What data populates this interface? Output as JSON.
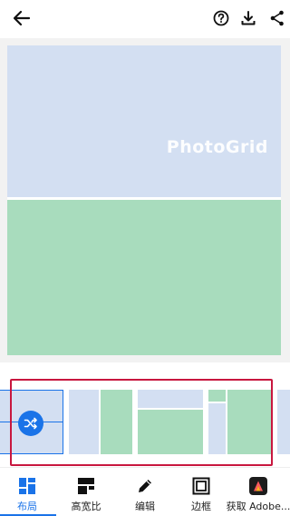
{
  "toolbar": {
    "back_icon": "arrow-left-icon",
    "help_icon": "help-circle-icon",
    "download_icon": "download-icon",
    "share_icon": "share-icon"
  },
  "canvas": {
    "watermark": "PhotoGrid",
    "top_cell_color": "#d3dff2",
    "bottom_cell_color": "#a8dcbd"
  },
  "layout_strip": {
    "highlight_color": "#c8173f",
    "selected_index": 0,
    "shuffle_icon": "shuffle-icon"
  },
  "bottom_nav": {
    "items": [
      {
        "label": "布局",
        "icon": "layout-grid-icon",
        "active": true
      },
      {
        "label": "高宽比",
        "icon": "aspect-ratio-icon",
        "active": false
      },
      {
        "label": "编辑",
        "icon": "pencil-icon",
        "active": false
      },
      {
        "label": "边框",
        "icon": "border-icon",
        "active": false
      },
      {
        "label": "获取 Adobe...",
        "icon": "adobe-express-icon",
        "active": false
      }
    ],
    "accent_color": "#1a73e8"
  }
}
